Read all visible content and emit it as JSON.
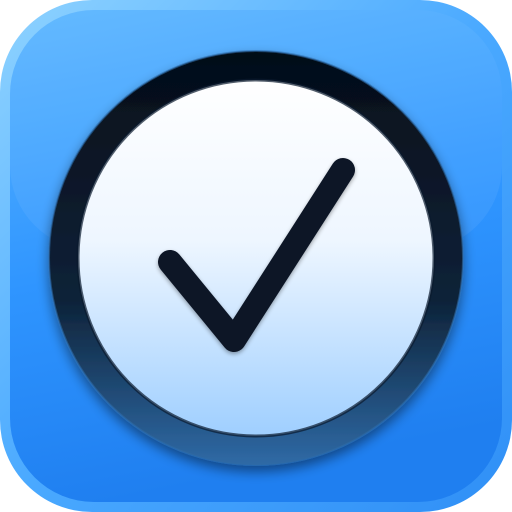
{
  "app_icon": {
    "glyph": "checkmark-icon",
    "colors": {
      "tile_highlight": "#8fd3ff",
      "tile_light": "#5bb6ff",
      "tile_base": "#2f95ff",
      "tile_deep": "#1f7ff0",
      "ring_dark": "#071628",
      "ring_mid": "#1a3f66",
      "ring_edge": "#2f6aa6",
      "face_top": "#ffffff",
      "face_bottom": "#9fcfff",
      "check_stroke": "#0b1626"
    }
  }
}
